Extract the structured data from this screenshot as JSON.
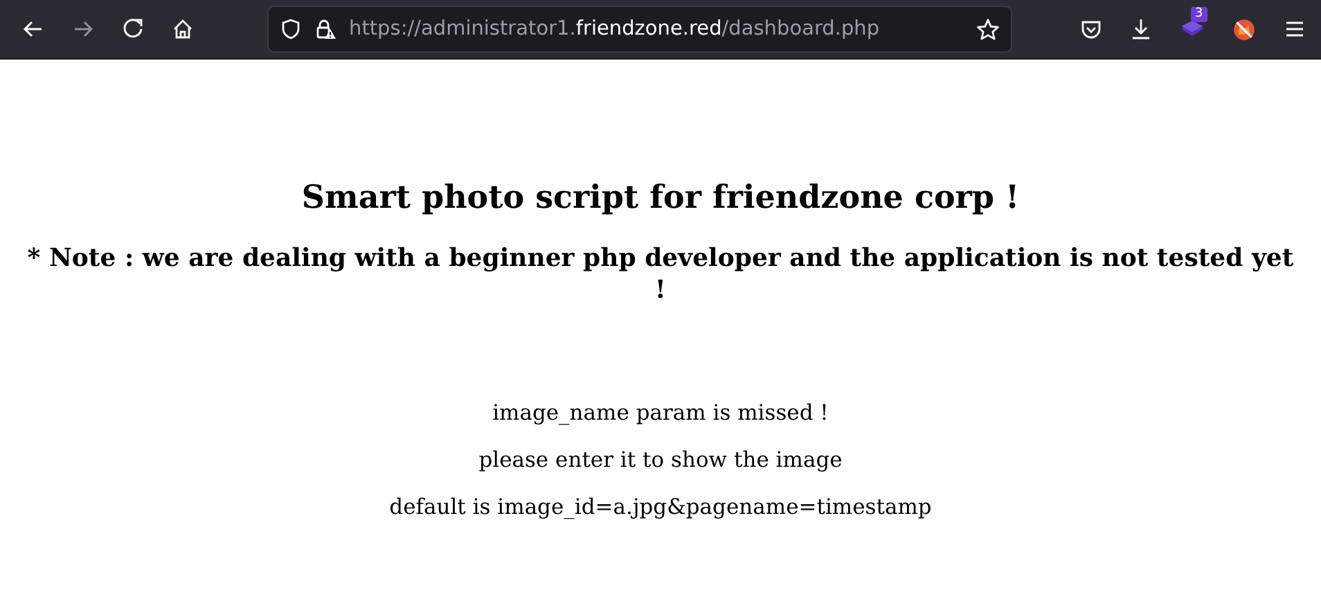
{
  "toolbar": {
    "nav_buttons": [
      {
        "kind": "back",
        "disabled": false
      },
      {
        "kind": "forward",
        "disabled": true
      },
      {
        "kind": "reload",
        "disabled": false
      },
      {
        "kind": "home",
        "disabled": false
      }
    ],
    "url": {
      "scheme_and_subdomain": "https://administrator1.",
      "domain": "friendzone.red",
      "path": "/dashboard.php"
    },
    "extension_badge": "3"
  },
  "page": {
    "title": "Smart photo script for friendzone corp !",
    "note": "* Note : we are dealing with a beginner php developer and the application is not tested yet !",
    "messages": [
      "image_name param is missed !",
      "please enter it to show the image",
      "default is image_id=a.jpg&pagename=timestamp"
    ]
  }
}
